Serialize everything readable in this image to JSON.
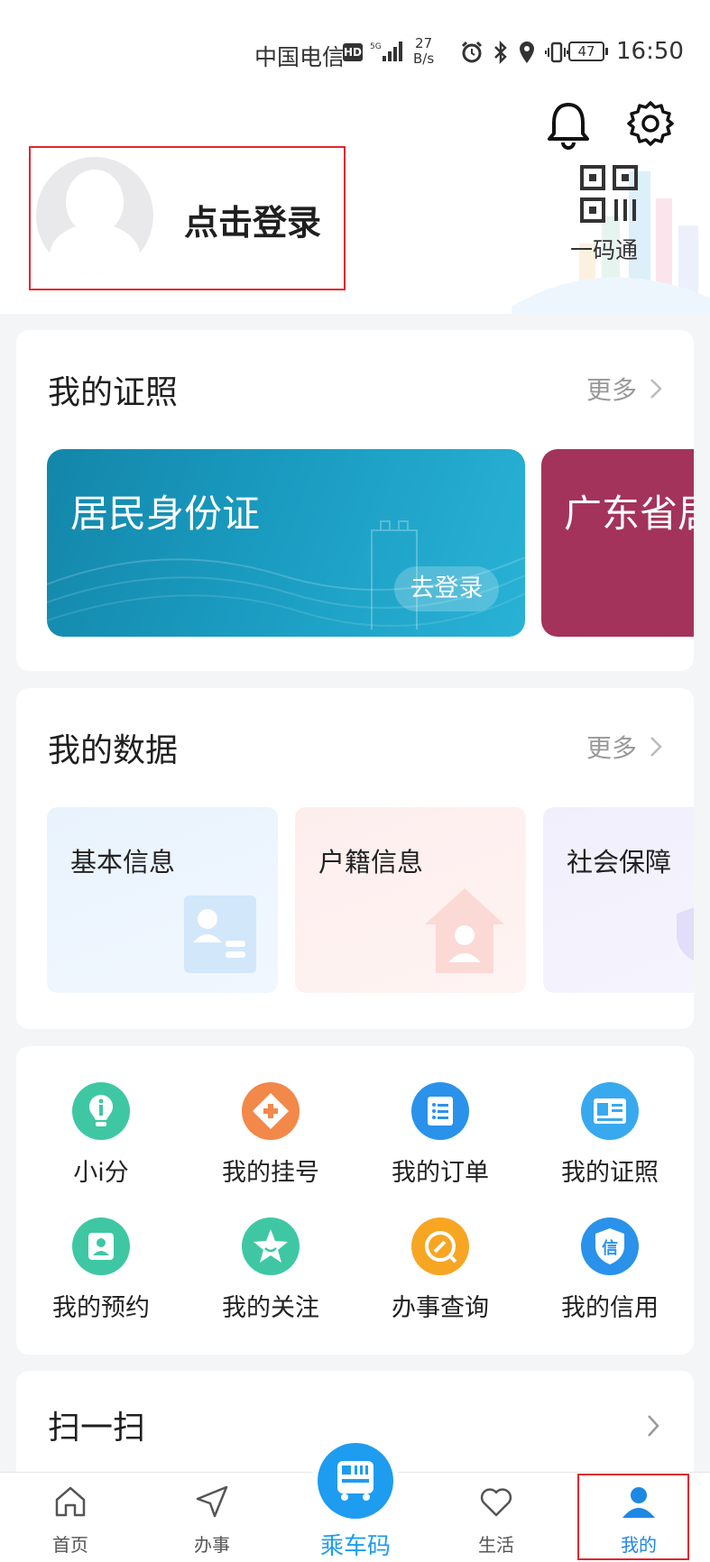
{
  "status_bar": {
    "carrier": "中国电信",
    "hd": "HD",
    "speed_value": "27",
    "speed_unit": "B/s",
    "battery": "47",
    "time": "16:50"
  },
  "header": {
    "login_label": "点击登录",
    "qr_label": "一码通"
  },
  "licenses": {
    "title": "我的证照",
    "more": "更多",
    "cards": [
      {
        "name": "居民身份证",
        "action": "去登录",
        "color": "#1a9bc0"
      },
      {
        "name": "广东省居",
        "color": "#a3335a"
      }
    ]
  },
  "my_data": {
    "title": "我的数据",
    "more": "更多",
    "tiles": [
      {
        "label": "基本信息"
      },
      {
        "label": "户籍信息"
      },
      {
        "label": "社会保障"
      }
    ]
  },
  "quick_grid": [
    {
      "label": "小i分",
      "icon": "lightbulb-icon",
      "color": "#3fc7a4"
    },
    {
      "label": "我的挂号",
      "icon": "medical-cross-icon",
      "color": "#f2884a"
    },
    {
      "label": "我的订单",
      "icon": "order-list-icon",
      "color": "#2a92ea"
    },
    {
      "label": "我的证照",
      "icon": "license-card-icon",
      "color": "#38a9ee"
    },
    {
      "label": "我的预约",
      "icon": "appointment-icon",
      "color": "#3fc7a4"
    },
    {
      "label": "我的关注",
      "icon": "star-icon",
      "color": "#3fc7a4"
    },
    {
      "label": "办事查询",
      "icon": "search-edit-icon",
      "color": "#f7a623"
    },
    {
      "label": "我的信用",
      "icon": "credit-shield-icon",
      "color": "#2a92ea"
    }
  ],
  "scan": {
    "title": "扫一扫"
  },
  "bottom_nav": {
    "home": "首页",
    "work": "办事",
    "bus": "乘车码",
    "life": "生活",
    "mine": "我的"
  },
  "colors": {
    "accent": "#1e88e5",
    "highlight_border": "#e3262d"
  }
}
